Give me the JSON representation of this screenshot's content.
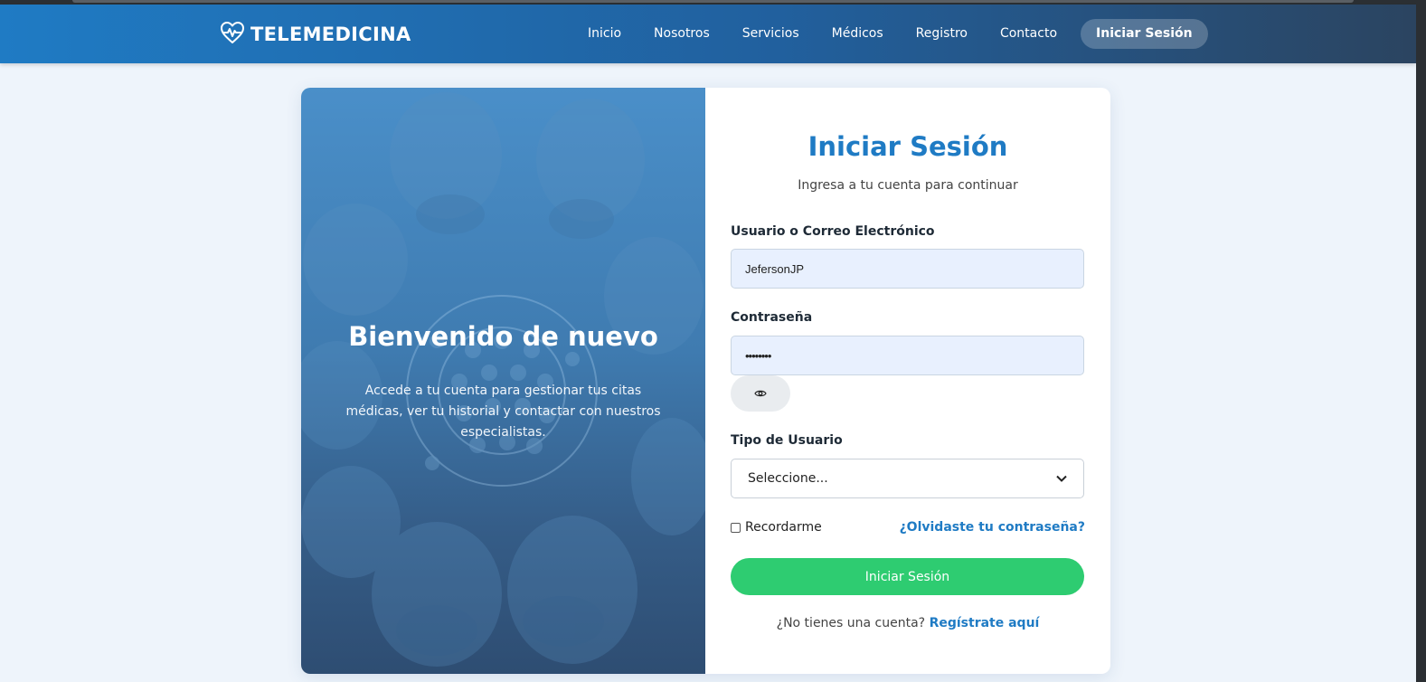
{
  "brand": {
    "name": "TELEMEDICINA",
    "logo_icon": "heart-pulse-icon"
  },
  "nav": {
    "links": [
      "Inicio",
      "Nosotros",
      "Servicios",
      "Médicos",
      "Registro",
      "Contacto"
    ],
    "active_link": "Iniciar Sesión"
  },
  "hero": {
    "title": "Bienvenido de nuevo",
    "text": "Accede a tu cuenta para gestionar tus citas médicas, ver tu historial y contactar con nuestros especialistas."
  },
  "form": {
    "title": "Iniciar Sesión",
    "subtitle": "Ingresa a tu cuenta para continuar",
    "username_label": "Usuario o Correo Electrónico",
    "username_value": "JefersonJP",
    "password_label": "Contraseña",
    "password_value": "••••••••",
    "toggle_icon": "eye-icon",
    "user_type_label": "Tipo de Usuario",
    "user_type_selected": "Seleccione...",
    "remember_label": "Recordarme",
    "forgot_label": "¿Olvidaste tu contraseña?",
    "submit_label": "Iniciar Sesión",
    "no_account_text": "¿No tienes una cuenta?",
    "register_link": "Regístrate aquí"
  },
  "colors": {
    "primary": "#1f7bc4",
    "success": "#2ecc71",
    "page_bg": "#eef4fb"
  }
}
